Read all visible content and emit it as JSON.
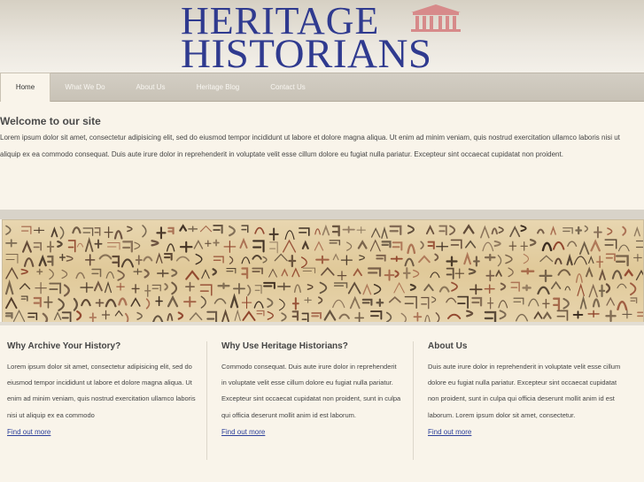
{
  "logo": {
    "line1": "HERITAGE",
    "line2": "HISTORIANS",
    "icon": "temple-icon",
    "color": "#2f3a8f",
    "icon_color": "#d78a8a"
  },
  "nav": {
    "items": [
      {
        "label": "Home",
        "active": true
      },
      {
        "label": "What We Do",
        "active": false
      },
      {
        "label": "About Us",
        "active": false
      },
      {
        "label": "Heritage Blog",
        "active": false
      },
      {
        "label": "Contact Us",
        "active": false
      }
    ]
  },
  "welcome": {
    "title": "Welcome to our site",
    "text": "Lorem ipsum dolor sit amet, consectetur adipisicing elit, sed do eiusmod tempor incididunt ut labore et dolore magna aliqua. Ut enim ad minim veniam, quis nostrud exercitation ullamco laboris nisi ut aliquip ex ea commodo consequat. Duis aute irure dolor in reprehenderit in voluptate velit esse cillum dolore eu fugiat nulla pariatur. Excepteur sint occaecat cupidatat non proident."
  },
  "banner": {
    "image": "hieroglyph-papyrus-image"
  },
  "columns": [
    {
      "title": "Why Archive Your History?",
      "text": "Lorem ipsum dolor sit amet, consectetur adipisicing elit, sed do eiusmod tempor incididunt ut labore et dolore magna aliqua. Ut enim ad minim veniam, quis nostrud exercitation ullamco laboris nisi ut aliquip ex ea commodo",
      "link": "Find out more"
    },
    {
      "title": "Why Use Heritage Historians?",
      "text": "Commodo consequat. Duis aute irure dolor in reprehenderit in voluptate velit esse cillum dolore eu fugiat nulla pariatur. Excepteur sint occaecat cupidatat non proident, sunt in culpa qui officia deserunt mollit anim id est laborum.",
      "link": "Find out more"
    },
    {
      "title": "About Us",
      "text": "Duis aute irure dolor in reprehenderit in voluptate velit esse cillum dolore eu fugiat nulla pariatur. Excepteur sint occaecat cupidatat non proident, sunt in culpa qui officia deserunt mollit anim id est laborum. Lorem ipsum dolor sit amet, consectetur.",
      "link": "Find out more"
    }
  ],
  "colors": {
    "background": "#f9f4ea",
    "nav": "#c8c2b6",
    "link": "#2b3f9a"
  }
}
